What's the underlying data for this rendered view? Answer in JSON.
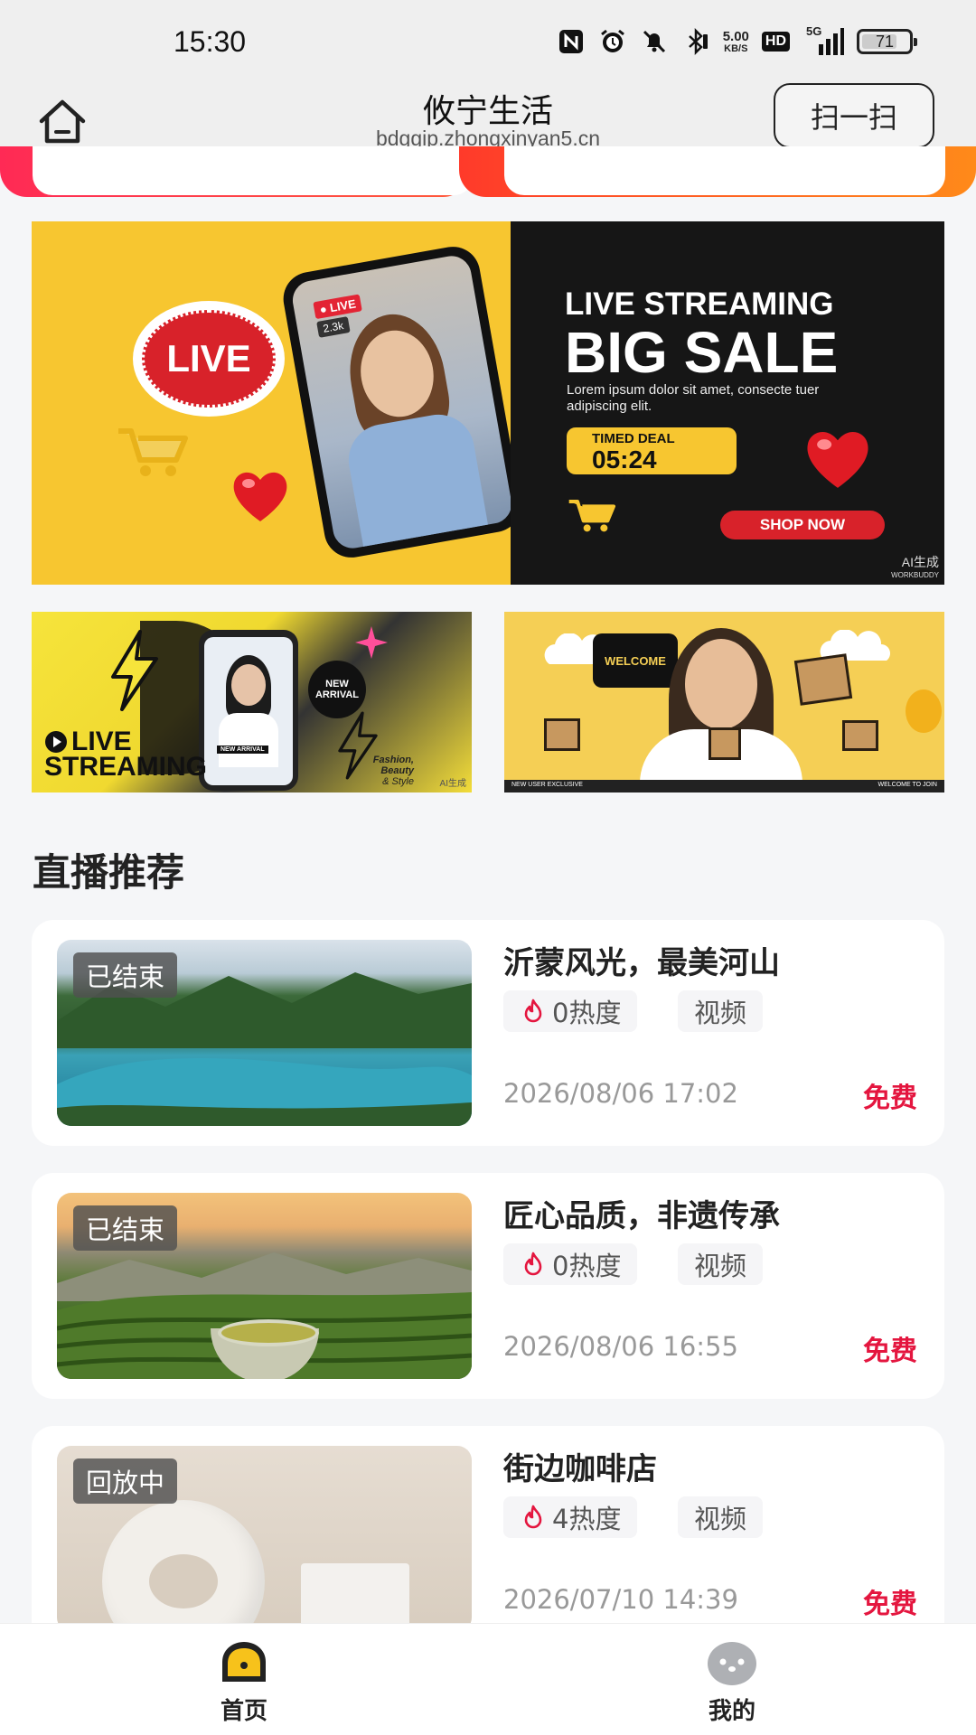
{
  "status_bar": {
    "time": "15:30",
    "speed_value": "5.00",
    "speed_unit": "KB/S",
    "hd": "HD",
    "network": "5G",
    "battery": "71"
  },
  "header": {
    "title": "攸宁生活",
    "url": "bdggip.zhongxinyan5.cn",
    "scan_label": "扫一扫"
  },
  "banner_main": {
    "live_badge": "LIVE",
    "phone_live": "● LIVE",
    "phone_views": "2.3k",
    "headline_1": "LIVE STREAMING",
    "headline_2": "BIG SALE",
    "body": "Lorem ipsum dolor sit amet, consecte tuer adipiscing elit.",
    "deal_label": "TIMED DEAL",
    "deal_time": "05:24",
    "shop_label": "SHOP NOW",
    "ai_mark": "AI生成",
    "ai_sub": "WORKBUDDY"
  },
  "banner_small_1": {
    "live_text_1": "LIVE",
    "live_text_2": "STREAMING",
    "badge": "NEW ARRIVAL",
    "phone_tag": "NEW ARRIVAL",
    "tag_1": "Fashion,",
    "tag_2": "Beauty",
    "tag_3": "& Style",
    "ai_mark": "AI生成"
  },
  "banner_small_2": {
    "welcome": "WELCOME",
    "footer_left": "NEW USER EXCLUSIVE",
    "footer_right": "WELCOME TO JOIN"
  },
  "section": {
    "title": "直播推荐"
  },
  "cards": [
    {
      "badge": "已结束",
      "title": "沂蒙风光，最美河山",
      "heat": "0热度",
      "type": "视频",
      "date": "2026/08/06 17:02",
      "price": "免费"
    },
    {
      "badge": "已结束",
      "title": "匠心品质，非遗传承",
      "heat": "0热度",
      "type": "视频",
      "date": "2026/08/06 16:55",
      "price": "免费"
    },
    {
      "badge": "回放中",
      "title": "街边咖啡店",
      "heat": "4热度",
      "type": "视频",
      "date": "2026/07/10 14:39",
      "price": "免费"
    }
  ],
  "bottom_nav": {
    "home": "首页",
    "mine": "我的"
  },
  "colors": {
    "accent_red": "#e4163f",
    "home_icon_yellow": "#f7c21b"
  }
}
